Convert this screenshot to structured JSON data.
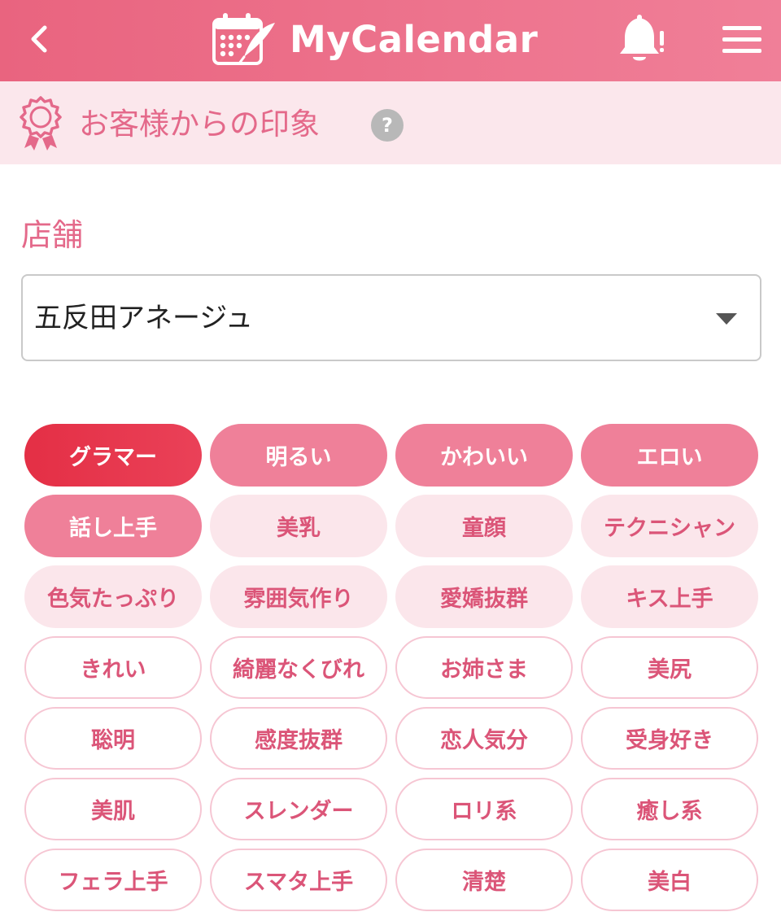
{
  "header": {
    "title": "MyCalendar",
    "back_icon": "chevron-left-icon",
    "logo_icon": "calendar-quill-icon",
    "bell_icon": "bell-alert-icon",
    "menu_icon": "hamburger-menu-icon",
    "colors": {
      "gradient_start": "#e9647f",
      "gradient_end": "#f07f98"
    }
  },
  "section": {
    "title": "お客様からの印象",
    "icon": "award-ribbon-icon",
    "help_label": "?"
  },
  "store": {
    "label": "店舗",
    "selected": "五反田アネージュ",
    "arrow_icon": "caret-down-icon"
  },
  "tags": [
    {
      "label": "グラマー",
      "level": "top"
    },
    {
      "label": "明るい",
      "level": "high"
    },
    {
      "label": "かわいい",
      "level": "high"
    },
    {
      "label": "エロい",
      "level": "high"
    },
    {
      "label": "話し上手",
      "level": "high"
    },
    {
      "label": "美乳",
      "level": "mid"
    },
    {
      "label": "童顔",
      "level": "mid"
    },
    {
      "label": "テクニシャン",
      "level": "mid"
    },
    {
      "label": "色気たっぷり",
      "level": "mid"
    },
    {
      "label": "雰囲気作り",
      "level": "mid"
    },
    {
      "label": "愛嬌抜群",
      "level": "mid"
    },
    {
      "label": "キス上手",
      "level": "mid"
    },
    {
      "label": "きれい",
      "level": "low"
    },
    {
      "label": "綺麗なくびれ",
      "level": "low"
    },
    {
      "label": "お姉さま",
      "level": "low"
    },
    {
      "label": "美尻",
      "level": "low"
    },
    {
      "label": "聡明",
      "level": "low"
    },
    {
      "label": "感度抜群",
      "level": "low"
    },
    {
      "label": "恋人気分",
      "level": "low"
    },
    {
      "label": "受身好き",
      "level": "low"
    },
    {
      "label": "美肌",
      "level": "low"
    },
    {
      "label": "スレンダー",
      "level": "low"
    },
    {
      "label": "ロリ系",
      "level": "low"
    },
    {
      "label": "癒し系",
      "level": "low"
    },
    {
      "label": "フェラ上手",
      "level": "low"
    },
    {
      "label": "スマタ上手",
      "level": "low"
    },
    {
      "label": "清楚",
      "level": "low"
    },
    {
      "label": "美白",
      "level": "low"
    }
  ],
  "colors": {
    "accent_pink": "#e4698a",
    "section_bg": "#fbe7ec",
    "tag_top": "#e42f45",
    "tag_high": "#ef8099",
    "tag_mid": "#fbe6eb",
    "tag_low_border": "#f6c6d3"
  }
}
